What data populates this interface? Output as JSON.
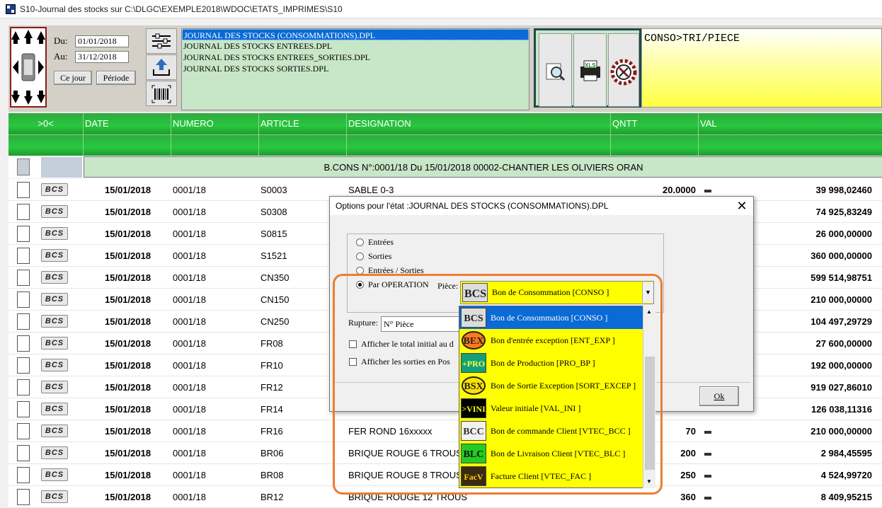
{
  "window": {
    "title": "S10-Journal des stocks sur C:\\DLGC\\EXEMPLE2018\\WDOC\\ETATS_IMPRIMES\\S10"
  },
  "dates": {
    "du_label": "Du:",
    "du_value": "01/01/2018",
    "au_label": "Au:",
    "au_value": "31/12/2018",
    "today_btn": "Ce jour",
    "period_btn": "Période"
  },
  "files": [
    "JOURNAL DES STOCKS (CONSOMMATIONS).DPL",
    "JOURNAL DES STOCKS ENTREES.DPL",
    "JOURNAL DES STOCKS ENTREES_SORTIES.DPL",
    "JOURNAL DES STOCKS SORTIES.DPL"
  ],
  "filter_text": "CONSO>TRI/PIECE",
  "grid": {
    "headers": [
      ">0<",
      "DATE",
      "NUMERO",
      "ARTICLE",
      "DESIGNATION",
      "QNTT",
      "VAL"
    ],
    "group_label": "B.CONS  N°:0001/18  Du 15/01/2018  00002-CHANTIER LES OLIVIERS ORAN",
    "badge": "BCS",
    "rows": [
      {
        "date": "15/01/2018",
        "numero": "0001/18",
        "article": "S0003",
        "designation": "SABLE 0-3",
        "qntt": "20.0000",
        "val": "39 998,02460"
      },
      {
        "date": "15/01/2018",
        "numero": "0001/18",
        "article": "S0308",
        "designation": "",
        "qntt": "",
        "val": "74 925,83249"
      },
      {
        "date": "15/01/2018",
        "numero": "0001/18",
        "article": "S0815",
        "designation": "",
        "qntt": "",
        "val": "26 000,00000"
      },
      {
        "date": "15/01/2018",
        "numero": "0001/18",
        "article": "S1521",
        "designation": "",
        "qntt": "",
        "val": "360 000,00000"
      },
      {
        "date": "15/01/2018",
        "numero": "0001/18",
        "article": "CN350",
        "designation": "",
        "qntt": "",
        "val": "599 514,98751"
      },
      {
        "date": "15/01/2018",
        "numero": "0001/18",
        "article": "CN150",
        "designation": "",
        "qntt": "",
        "val": "210 000,00000"
      },
      {
        "date": "15/01/2018",
        "numero": "0001/18",
        "article": "CN250",
        "designation": "",
        "qntt": "",
        "val": "104 497,29729"
      },
      {
        "date": "15/01/2018",
        "numero": "0001/18",
        "article": "FR08",
        "designation": "",
        "qntt": "",
        "val": "27 600,00000"
      },
      {
        "date": "15/01/2018",
        "numero": "0001/18",
        "article": "FR10",
        "designation": "",
        "qntt": "",
        "val": "192 000,00000"
      },
      {
        "date": "15/01/2018",
        "numero": "0001/18",
        "article": "FR12",
        "designation": "",
        "qntt": "",
        "val": "919 027,86010"
      },
      {
        "date": "15/01/2018",
        "numero": "0001/18",
        "article": "FR14",
        "designation": "",
        "qntt": "",
        "val": "126 038,11316"
      },
      {
        "date": "15/01/2018",
        "numero": "0001/18",
        "article": "FR16",
        "designation": "FER ROND 16xxxxx",
        "qntt": "70",
        "val": "210 000,00000"
      },
      {
        "date": "15/01/2018",
        "numero": "0001/18",
        "article": "BR06",
        "designation": "BRIQUE ROUGE 6 TROUS",
        "qntt": "200",
        "val": "2 984,45595"
      },
      {
        "date": "15/01/2018",
        "numero": "0001/18",
        "article": "BR08",
        "designation": "BRIQUE ROUGE 8 TROUS",
        "qntt": "250",
        "val": "4 524,99720"
      },
      {
        "date": "15/01/2018",
        "numero": "0001/18",
        "article": "BR12",
        "designation": "BRIQUE ROUGE 12 TROUS",
        "qntt": "360",
        "val": "8 409,95215"
      }
    ]
  },
  "dialog": {
    "title": "Options pour l'état :JOURNAL DES STOCKS (CONSOMMATIONS).DPL",
    "close": "✕",
    "radio_entrees": "Entrées",
    "radio_sorties": "Sorties",
    "radio_es": "Entrées / Sorties",
    "radio_operation": "Par OPERATION",
    "piece_label": "Pièce:",
    "rupture_label": "Rupture:",
    "rupture_value": "N° Pièce",
    "cb_total": "Afficher le total initial au d",
    "cb_sorties": "Afficher les sorties en Pos",
    "ok": "Ok",
    "combo_value": "Bon de Consommation [CONSO     ]",
    "combo_icon": "BCS"
  },
  "dropdown": [
    {
      "icon": "BCS",
      "label": "Bon de Consommation [CONSO     ]",
      "selected": true
    },
    {
      "icon": "BEX",
      "label": "Bon d'entrée exception [ENT_EXP    ]"
    },
    {
      "icon": "+PRO",
      "label": "Bon de Production [PRO_BP     ]"
    },
    {
      "icon": "BSX",
      "label": "Bon de Sortie Exception [SORT_EXCEP ]"
    },
    {
      "icon": ">VINI",
      "label": "Valeur initiale [VAL_INI    ]"
    },
    {
      "icon": "BCC",
      "label": "Bon de commande Client [VTEC_BCC   ]"
    },
    {
      "icon": "BLC",
      "label": "Bon de Livraison Client [VTEC_BLC   ]"
    },
    {
      "icon": "FacV",
      "label": "Facture Client [VTEC_FAC   ]"
    }
  ],
  "colors": {
    "grid_header": "#28c83f",
    "selection": "#0a6ad6",
    "dropdown_bg": "#ffff00",
    "highlight_outline": "#ed7d31",
    "filelist_bg": "#c8e6c8"
  }
}
